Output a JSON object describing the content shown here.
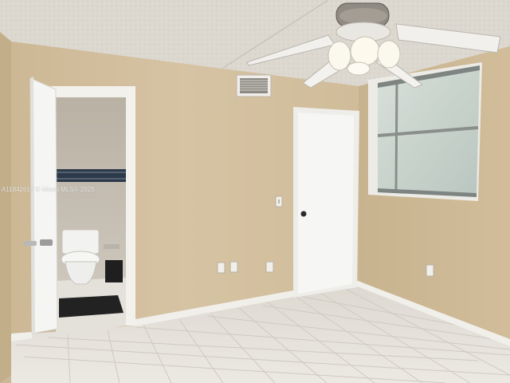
{
  "watermark": "A11842619 © Miami MLS® 2025",
  "colors": {
    "ceiling": "#ddd9d1",
    "wall": "#d3bf9e",
    "wall_right": "#cdb893",
    "floor": "#e6e2da",
    "trim": "#f2f0eb",
    "door": "#f4f4f2",
    "window_glass": "#c9d2cc",
    "bathroom": "#cbc3b6",
    "bath_tile_band": "#2d3a4a"
  },
  "icons": {
    "ceiling_fan": "ceiling-fan-icon",
    "air_vent": "air-vent-icon",
    "toilet": "toilet-icon",
    "light_switch": "light-switch-icon",
    "outlet": "outlet-icon"
  }
}
